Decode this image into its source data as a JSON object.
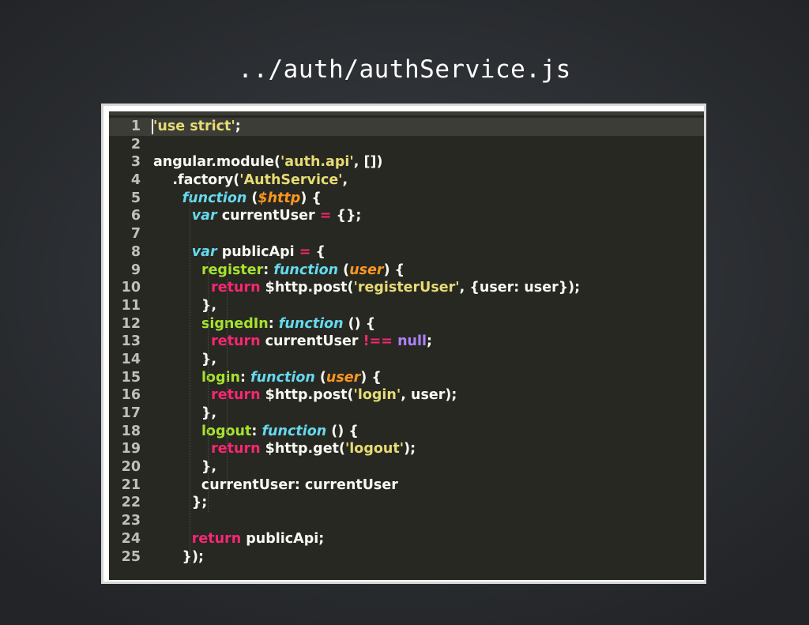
{
  "slide": {
    "title": "../auth/authService.js"
  },
  "editor": {
    "active_line": 1,
    "lines": [
      {
        "num": "1",
        "tokens": [
          {
            "t": "'use strict'",
            "c": "str"
          },
          {
            "t": ";",
            "c": "pl"
          }
        ]
      },
      {
        "num": "2",
        "tokens": []
      },
      {
        "num": "3",
        "tokens": [
          {
            "t": "angular.module(",
            "c": "pl"
          },
          {
            "t": "'auth.api'",
            "c": "str"
          },
          {
            "t": ", [])",
            "c": "pl"
          }
        ]
      },
      {
        "num": "4",
        "tokens": [
          {
            "t": "    .factory(",
            "c": "pl"
          },
          {
            "t": "'AuthService'",
            "c": "str"
          },
          {
            "t": ",",
            "c": "pl"
          }
        ]
      },
      {
        "num": "5",
        "tokens": [
          {
            "t": "      ",
            "c": "pl"
          },
          {
            "t": "function",
            "c": "fn"
          },
          {
            "t": " (",
            "c": "pl"
          },
          {
            "t": "$http",
            "c": "prm"
          },
          {
            "t": ") {",
            "c": "pl"
          }
        ]
      },
      {
        "num": "6",
        "tokens": [
          {
            "t": "        ",
            "c": "pl"
          },
          {
            "t": "var",
            "c": "fn"
          },
          {
            "t": " currentUser ",
            "c": "pl"
          },
          {
            "t": "=",
            "c": "kw"
          },
          {
            "t": " {};",
            "c": "pl"
          }
        ]
      },
      {
        "num": "7",
        "tokens": []
      },
      {
        "num": "8",
        "tokens": [
          {
            "t": "        ",
            "c": "pl"
          },
          {
            "t": "var",
            "c": "fn"
          },
          {
            "t": " publicApi ",
            "c": "pl"
          },
          {
            "t": "=",
            "c": "kw"
          },
          {
            "t": " {",
            "c": "pl"
          }
        ]
      },
      {
        "num": "9",
        "tokens": [
          {
            "t": "          ",
            "c": "pl"
          },
          {
            "t": "register",
            "c": "prop"
          },
          {
            "t": ": ",
            "c": "pl"
          },
          {
            "t": "function",
            "c": "fn"
          },
          {
            "t": " (",
            "c": "pl"
          },
          {
            "t": "user",
            "c": "prm"
          },
          {
            "t": ") {",
            "c": "pl"
          }
        ]
      },
      {
        "num": "10",
        "tokens": [
          {
            "t": "            ",
            "c": "pl"
          },
          {
            "t": "return",
            "c": "kw"
          },
          {
            "t": " $http.post(",
            "c": "pl"
          },
          {
            "t": "'registerUser'",
            "c": "str"
          },
          {
            "t": ", {user: user});",
            "c": "pl"
          }
        ]
      },
      {
        "num": "11",
        "tokens": [
          {
            "t": "          },",
            "c": "pl"
          }
        ]
      },
      {
        "num": "12",
        "tokens": [
          {
            "t": "          ",
            "c": "pl"
          },
          {
            "t": "signedIn",
            "c": "prop"
          },
          {
            "t": ": ",
            "c": "pl"
          },
          {
            "t": "function",
            "c": "fn"
          },
          {
            "t": " () {",
            "c": "pl"
          }
        ]
      },
      {
        "num": "13",
        "tokens": [
          {
            "t": "            ",
            "c": "pl"
          },
          {
            "t": "return",
            "c": "kw"
          },
          {
            "t": " currentUser ",
            "c": "pl"
          },
          {
            "t": "!==",
            "c": "kw"
          },
          {
            "t": " ",
            "c": "pl"
          },
          {
            "t": "null",
            "c": "cst"
          },
          {
            "t": ";",
            "c": "pl"
          }
        ]
      },
      {
        "num": "14",
        "tokens": [
          {
            "t": "          },",
            "c": "pl"
          }
        ]
      },
      {
        "num": "15",
        "tokens": [
          {
            "t": "          ",
            "c": "pl"
          },
          {
            "t": "login",
            "c": "prop"
          },
          {
            "t": ": ",
            "c": "pl"
          },
          {
            "t": "function",
            "c": "fn"
          },
          {
            "t": " (",
            "c": "pl"
          },
          {
            "t": "user",
            "c": "prm"
          },
          {
            "t": ") {",
            "c": "pl"
          }
        ]
      },
      {
        "num": "16",
        "tokens": [
          {
            "t": "            ",
            "c": "pl"
          },
          {
            "t": "return",
            "c": "kw"
          },
          {
            "t": " $http.post(",
            "c": "pl"
          },
          {
            "t": "'login'",
            "c": "str"
          },
          {
            "t": ", user);",
            "c": "pl"
          }
        ]
      },
      {
        "num": "17",
        "tokens": [
          {
            "t": "          },",
            "c": "pl"
          }
        ]
      },
      {
        "num": "18",
        "tokens": [
          {
            "t": "          ",
            "c": "pl"
          },
          {
            "t": "logout",
            "c": "prop"
          },
          {
            "t": ": ",
            "c": "pl"
          },
          {
            "t": "function",
            "c": "fn"
          },
          {
            "t": " () {",
            "c": "pl"
          }
        ]
      },
      {
        "num": "19",
        "tokens": [
          {
            "t": "            ",
            "c": "pl"
          },
          {
            "t": "return",
            "c": "kw"
          },
          {
            "t": " $http.get(",
            "c": "pl"
          },
          {
            "t": "'logout'",
            "c": "str"
          },
          {
            "t": ");",
            "c": "pl"
          }
        ]
      },
      {
        "num": "20",
        "tokens": [
          {
            "t": "          },",
            "c": "pl"
          }
        ]
      },
      {
        "num": "21",
        "tokens": [
          {
            "t": "          currentUser: currentUser",
            "c": "pl"
          }
        ]
      },
      {
        "num": "22",
        "tokens": [
          {
            "t": "        };",
            "c": "pl"
          }
        ]
      },
      {
        "num": "23",
        "tokens": []
      },
      {
        "num": "24",
        "tokens": [
          {
            "t": "        ",
            "c": "pl"
          },
          {
            "t": "return",
            "c": "kw"
          },
          {
            "t": " publicApi;",
            "c": "pl"
          }
        ]
      },
      {
        "num": "25",
        "tokens": [
          {
            "t": "      });",
            "c": "pl"
          }
        ]
      }
    ]
  },
  "colors": {
    "background": "#2c2f33",
    "editor_bg": "#272822",
    "keyword": "#f92672",
    "storage": "#66d9ef",
    "string": "#e6db74",
    "property": "#a6e22e",
    "parameter": "#fd971f",
    "constant": "#ae81ff",
    "text": "#f8f8f2"
  }
}
